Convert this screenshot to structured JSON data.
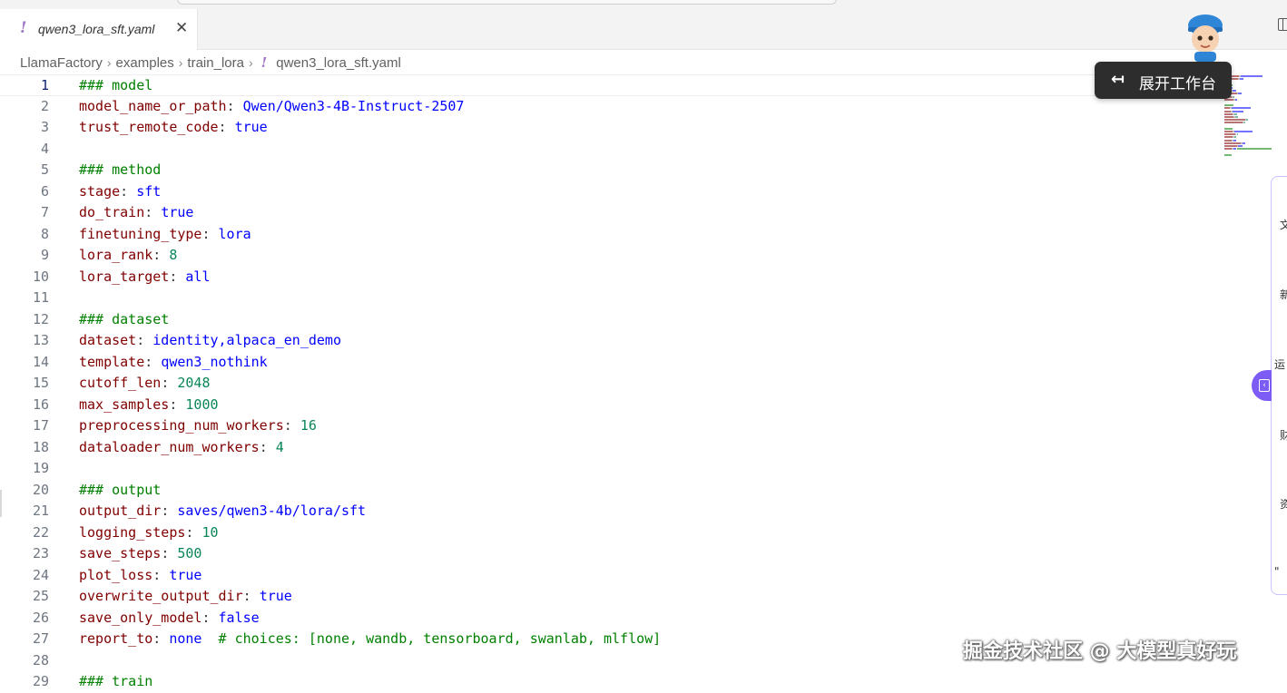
{
  "tab": {
    "icon": "!",
    "title": "qwen3_lora_sft.yaml",
    "close": "✕"
  },
  "breadcrumb": {
    "items": [
      "LlamaFactory",
      "examples",
      "train_lora"
    ],
    "file_icon": "!",
    "file": "qwen3_lora_sft.yaml"
  },
  "tooltip": {
    "icon": "↤",
    "label": "展开工作台"
  },
  "side_panel": {
    "items": [
      "文",
      "新",
      "运",
      "财",
      "资",
      "\""
    ]
  },
  "watermark": "掘金技术社区 @ 大模型真好玩",
  "editor": {
    "current_line": 1,
    "lines": [
      {
        "n": "1",
        "tokens": [
          {
            "t": "### model",
            "c": "comment"
          }
        ]
      },
      {
        "n": "2",
        "tokens": [
          {
            "t": "model_name_or_path",
            "c": "key"
          },
          {
            "t": ": ",
            "c": "punct"
          },
          {
            "t": "Qwen/Qwen3-4B-Instruct-2507",
            "c": "str"
          }
        ]
      },
      {
        "n": "3",
        "tokens": [
          {
            "t": "trust_remote_code",
            "c": "key"
          },
          {
            "t": ": ",
            "c": "punct"
          },
          {
            "t": "true",
            "c": "str"
          }
        ]
      },
      {
        "n": "4",
        "tokens": []
      },
      {
        "n": "5",
        "tokens": [
          {
            "t": "### method",
            "c": "comment"
          }
        ]
      },
      {
        "n": "6",
        "tokens": [
          {
            "t": "stage",
            "c": "key"
          },
          {
            "t": ": ",
            "c": "punct"
          },
          {
            "t": "sft",
            "c": "str"
          }
        ]
      },
      {
        "n": "7",
        "tokens": [
          {
            "t": "do_train",
            "c": "key"
          },
          {
            "t": ": ",
            "c": "punct"
          },
          {
            "t": "true",
            "c": "str"
          }
        ]
      },
      {
        "n": "8",
        "tokens": [
          {
            "t": "finetuning_type",
            "c": "key"
          },
          {
            "t": ": ",
            "c": "punct"
          },
          {
            "t": "lora",
            "c": "str"
          }
        ]
      },
      {
        "n": "9",
        "tokens": [
          {
            "t": "lora_rank",
            "c": "key"
          },
          {
            "t": ": ",
            "c": "punct"
          },
          {
            "t": "8",
            "c": "num"
          }
        ]
      },
      {
        "n": "10",
        "tokens": [
          {
            "t": "lora_target",
            "c": "key"
          },
          {
            "t": ": ",
            "c": "punct"
          },
          {
            "t": "all",
            "c": "str"
          }
        ]
      },
      {
        "n": "11",
        "tokens": []
      },
      {
        "n": "12",
        "tokens": [
          {
            "t": "### dataset",
            "c": "comment"
          }
        ]
      },
      {
        "n": "13",
        "tokens": [
          {
            "t": "dataset",
            "c": "key"
          },
          {
            "t": ": ",
            "c": "punct"
          },
          {
            "t": "identity,alpaca_en_demo",
            "c": "str"
          }
        ]
      },
      {
        "n": "14",
        "tokens": [
          {
            "t": "template",
            "c": "key"
          },
          {
            "t": ": ",
            "c": "punct"
          },
          {
            "t": "qwen3_nothink",
            "c": "str"
          }
        ]
      },
      {
        "n": "15",
        "tokens": [
          {
            "t": "cutoff_len",
            "c": "key"
          },
          {
            "t": ": ",
            "c": "punct"
          },
          {
            "t": "2048",
            "c": "num"
          }
        ]
      },
      {
        "n": "16",
        "tokens": [
          {
            "t": "max_samples",
            "c": "key"
          },
          {
            "t": ": ",
            "c": "punct"
          },
          {
            "t": "1000",
            "c": "num"
          }
        ]
      },
      {
        "n": "17",
        "tokens": [
          {
            "t": "preprocessing_num_workers",
            "c": "key"
          },
          {
            "t": ": ",
            "c": "punct"
          },
          {
            "t": "16",
            "c": "num"
          }
        ]
      },
      {
        "n": "18",
        "tokens": [
          {
            "t": "dataloader_num_workers",
            "c": "key"
          },
          {
            "t": ": ",
            "c": "punct"
          },
          {
            "t": "4",
            "c": "num"
          }
        ]
      },
      {
        "n": "19",
        "tokens": []
      },
      {
        "n": "20",
        "tokens": [
          {
            "t": "### output",
            "c": "comment"
          }
        ]
      },
      {
        "n": "21",
        "tokens": [
          {
            "t": "output_dir",
            "c": "key"
          },
          {
            "t": ": ",
            "c": "punct"
          },
          {
            "t": "saves/qwen3-4b/lora/sft",
            "c": "str"
          }
        ]
      },
      {
        "n": "22",
        "tokens": [
          {
            "t": "logging_steps",
            "c": "key"
          },
          {
            "t": ": ",
            "c": "punct"
          },
          {
            "t": "10",
            "c": "num"
          }
        ]
      },
      {
        "n": "23",
        "tokens": [
          {
            "t": "save_steps",
            "c": "key"
          },
          {
            "t": ": ",
            "c": "punct"
          },
          {
            "t": "500",
            "c": "num"
          }
        ]
      },
      {
        "n": "24",
        "tokens": [
          {
            "t": "plot_loss",
            "c": "key"
          },
          {
            "t": ": ",
            "c": "punct"
          },
          {
            "t": "true",
            "c": "str"
          }
        ]
      },
      {
        "n": "25",
        "tokens": [
          {
            "t": "overwrite_output_dir",
            "c": "key"
          },
          {
            "t": ": ",
            "c": "punct"
          },
          {
            "t": "true",
            "c": "str"
          }
        ]
      },
      {
        "n": "26",
        "tokens": [
          {
            "t": "save_only_model",
            "c": "key"
          },
          {
            "t": ": ",
            "c": "punct"
          },
          {
            "t": "false",
            "c": "str"
          }
        ]
      },
      {
        "n": "27",
        "tokens": [
          {
            "t": "report_to",
            "c": "key"
          },
          {
            "t": ": ",
            "c": "punct"
          },
          {
            "t": "none",
            "c": "str"
          },
          {
            "t": "  # choices: [none, wandb, tensorboard, swanlab, mlflow]",
            "c": "comment"
          }
        ]
      },
      {
        "n": "28",
        "tokens": []
      },
      {
        "n": "29",
        "tokens": [
          {
            "t": "### train",
            "c": "comment"
          }
        ]
      }
    ]
  },
  "colors": {
    "comment": "#008000",
    "key": "#800000",
    "string": "#0000ff",
    "number": "#098658",
    "accent": "#7c5cf5"
  }
}
